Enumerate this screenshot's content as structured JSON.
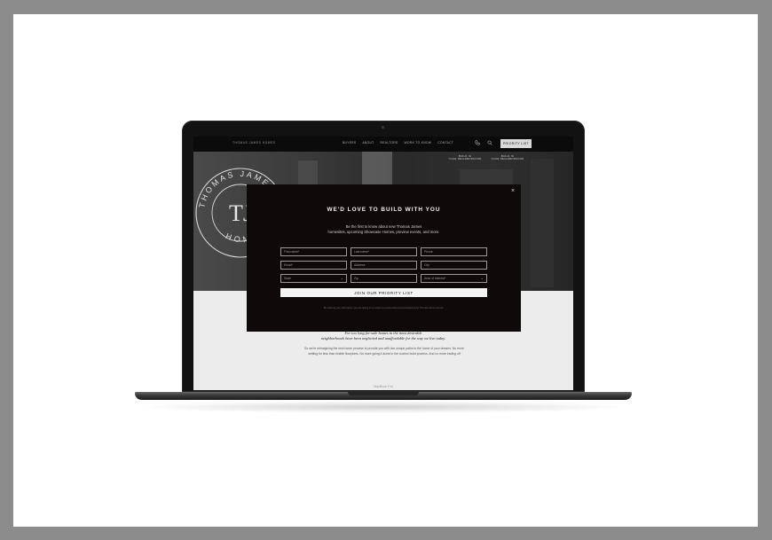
{
  "laptop": {
    "model_label": "MacBook Pro"
  },
  "site": {
    "brand": "THOMAS JAMES HOMES",
    "nav": [
      "BUYERS",
      "ABOUT",
      "REALTORS",
      "WORK TO KNOW",
      "CONTACT"
    ],
    "phone_icon": "phone-icon",
    "search_icon": "search-icon",
    "cta": "PRIORITY LIST",
    "hero_tags": [
      {
        "line1": "BUILD IN",
        "line2": "YOUR NEIGHBORHOOD"
      },
      {
        "line1": "BUILD IN",
        "line2": "YOUR NEIGHBORHOOD"
      }
    ],
    "logo": {
      "top_text": "THOMAS JAMES",
      "monogram": "TJ",
      "bottom_text": "HOMES"
    },
    "lower_italic_1": "For too long for-sale homes in the most desirable",
    "lower_italic_2": "neighborhoods have been neglected and unaffordable for the way we live today.",
    "lower_body_1": "So we're reimagining the new home process to provide you with two unique paths to the home of your dreams. No more",
    "lower_body_2": "settling for less than livable floorplans. No more going it alone in the custom build process. And no more trading off"
  },
  "modal": {
    "close": "×",
    "title": "WE'D LOVE TO BUILD WITH YOU",
    "subtitle_1": "Be the first to know about new Thomas James",
    "subtitle_2": "homesites, upcoming Showcase Homes, preview events, and more.",
    "fields": {
      "first_name": "First name*",
      "last_name": "Last name*",
      "phone": "Phone",
      "email": "Email*",
      "address": "Address",
      "city": "City",
      "state": "State",
      "zip": "Zip",
      "area": "Area of interest*"
    },
    "submit": "JOIN OUR PRIORITY LIST",
    "legal": "By entering your information, you are opting in to receive text and email communications from Thomas James Homes."
  }
}
